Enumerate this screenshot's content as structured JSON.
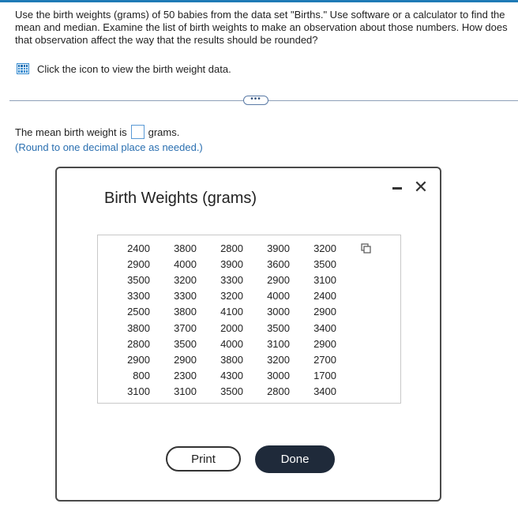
{
  "question": {
    "text": "Use the birth weights (grams) of 50 babies from the data set \"Births.\" Use software or a calculator to find the mean and median. Examine the list of birth weights to make an observation about those numbers. How does that observation affect the way that the results should be rounded?"
  },
  "data_link": {
    "icon": "table-grid-icon",
    "label": "Click the icon to view the birth weight data."
  },
  "more_button": {
    "label": "•••"
  },
  "answer": {
    "prefix": "The mean birth weight is",
    "value": "",
    "suffix": "grams.",
    "hint": "(Round to one decimal place as needed.)"
  },
  "modal": {
    "title": "Birth Weights (grams)",
    "minimize_icon": "minimize-icon",
    "close_icon": "close-icon",
    "close_glyph": "✕",
    "copy_icon": "copy-icon",
    "rows": [
      [
        "2400",
        "3800",
        "2800",
        "3900",
        "3200"
      ],
      [
        "2900",
        "4000",
        "3900",
        "3600",
        "3500"
      ],
      [
        "3500",
        "3200",
        "3300",
        "2900",
        "3100"
      ],
      [
        "3300",
        "3300",
        "3200",
        "4000",
        "2400"
      ],
      [
        "2500",
        "3800",
        "4100",
        "3000",
        "2900"
      ],
      [
        "3800",
        "3700",
        "2000",
        "3500",
        "3400"
      ],
      [
        "2800",
        "3500",
        "4000",
        "3100",
        "2900"
      ],
      [
        "2900",
        "2900",
        "3800",
        "3200",
        "2700"
      ],
      [
        "800",
        "2300",
        "4300",
        "3000",
        "1700"
      ],
      [
        "3100",
        "3100",
        "3500",
        "2800",
        "3400"
      ]
    ],
    "print_label": "Print",
    "done_label": "Done"
  },
  "colors": {
    "accent": "#1f7bb6",
    "hint_text": "#2a6fb0",
    "done_button_bg": "#1f2a3a"
  }
}
